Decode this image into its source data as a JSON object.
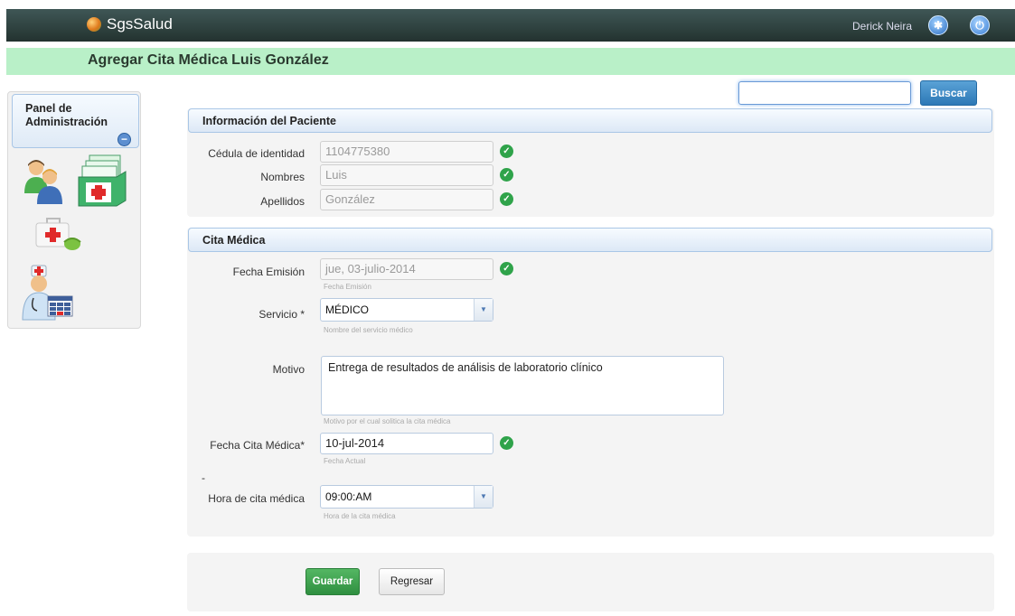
{
  "app": {
    "name": "SgsSalud",
    "user": "Derick Neira"
  },
  "page": {
    "title": "Agregar Cita Médica Luis González"
  },
  "sidebar": {
    "title": "Panel de Administración"
  },
  "search": {
    "value": "",
    "button": "Buscar"
  },
  "patient": {
    "section_title": "Información del Paciente",
    "fields": [
      {
        "label": "Cédula de identidad",
        "value": "1104775380"
      },
      {
        "label": "Nombres",
        "value": "Luis"
      },
      {
        "label": "Apellidos",
        "value": "González"
      }
    ]
  },
  "appointment": {
    "section_title": "Cita Médica",
    "emission_date": {
      "label": "Fecha Emisión",
      "value": "jue, 03-julio-2014",
      "hint": "Fecha Emisión"
    },
    "service": {
      "label": "Servicio *",
      "value": "MÉDICO",
      "hint": "Nombre del servicio médico"
    },
    "reason": {
      "label": "Motivo",
      "value": "Entrega de resultados de análisis de laboratorio clínico",
      "hint": "Motivo por el cual solitica la cita médica"
    },
    "appointment_date": {
      "label": "Fecha Cita Médica*",
      "value": "10-jul-2014",
      "hint": "Fecha Actual"
    },
    "separator": "-",
    "appointment_time": {
      "label": "Hora de cita médica",
      "value": "09:00:AM",
      "hint": "Hora de la cita médica"
    }
  },
  "actions": {
    "save": "Guardar",
    "back": "Regresar"
  },
  "icons": {
    "settings": "settings-icon",
    "power": "power-icon",
    "valid": "check-circle-icon",
    "dropdown": "chevron-down-icon"
  },
  "colors": {
    "topbar": "#2f4240",
    "titlebar": "#b9f0c8",
    "primary": "#2c78b6",
    "success": "#2f8f40"
  }
}
